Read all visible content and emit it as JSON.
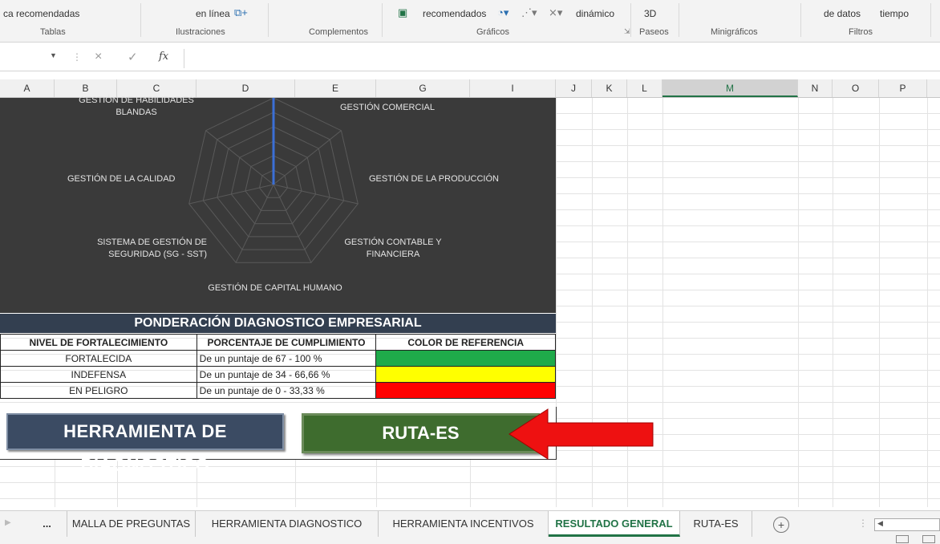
{
  "ribbon": {
    "items": {
      "charts_rec": "ca recomendadas",
      "online": "en línea",
      "rec2": "recomendados",
      "dynamic": "dinámico",
      "threed": "3D",
      "data": "de datos",
      "time": "tiempo"
    },
    "groups": {
      "tables": "Tablas",
      "illustrations": "Ilustraciones",
      "addins": "Complementos",
      "charts": "Gráficos",
      "tours": "Paseos",
      "sparklines": "Minigráficos",
      "filters": "Filtros"
    }
  },
  "formula_bar": {
    "fx": "fx",
    "cancel": "×",
    "enter": "✓",
    "value": ""
  },
  "columns": [
    "A",
    "B",
    "C",
    "D",
    "E",
    "G",
    "I",
    "J",
    "K",
    "L",
    "M",
    "N",
    "O",
    "P"
  ],
  "radar": {
    "labels": {
      "top_left": "GESTIÓN DE HABILIDADES BLANDAS",
      "top_right": "GESTIÓN COMERCIAL",
      "left": "GESTIÓN DE LA CALIDAD",
      "right": "GESTIÓN DE LA PRODUCCIÓN",
      "bottom_left": "SISTEMA DE GESTIÓN DE SEGURIDAD (SG - SST)",
      "bottom_right": "GESTIÓN CONTABLE Y FINANCIERA",
      "bottom": "GESTIÓN DE CAPITAL HUMANO"
    },
    "series_color": "#3b6fd6",
    "background": "#3a3a3a"
  },
  "ponderacion": {
    "title": "PONDERACIÓN DIAGNOSTICO EMPRESARIAL",
    "headers": [
      "NIVEL DE FORTALECIMIENTO",
      "PORCENTAJE DE CUMPLIMIENTO",
      "COLOR DE REFERENCIA"
    ],
    "rows": [
      {
        "nivel": "FORTALECIDA",
        "porcentaje": "De un puntaje de 67 - 100 %",
        "color": "#1faa4a"
      },
      {
        "nivel": "INDEFENSA",
        "porcentaje": "De un puntaje de 34 - 66,66 %",
        "color": "#ffff00"
      },
      {
        "nivel": "EN PELIGRO",
        "porcentaje": "De un puntaje de 0 - 33,33 %",
        "color": "#ff0000"
      }
    ]
  },
  "buttons": {
    "diagnostico": "HERRAMIENTA DE DIAGNOSTICO",
    "ruta": "RUTA-ES"
  },
  "arrow_color": "#ee1111",
  "sheet_tabs": {
    "more": "...",
    "items": [
      "MALLA DE PREGUNTAS",
      "HERRAMIENTA DIAGNOSTICO",
      "HERRAMIENTA INCENTIVOS",
      "RESULTADO GENERAL",
      "RUTA-ES"
    ],
    "active": "RESULTADO GENERAL",
    "add": "+"
  }
}
